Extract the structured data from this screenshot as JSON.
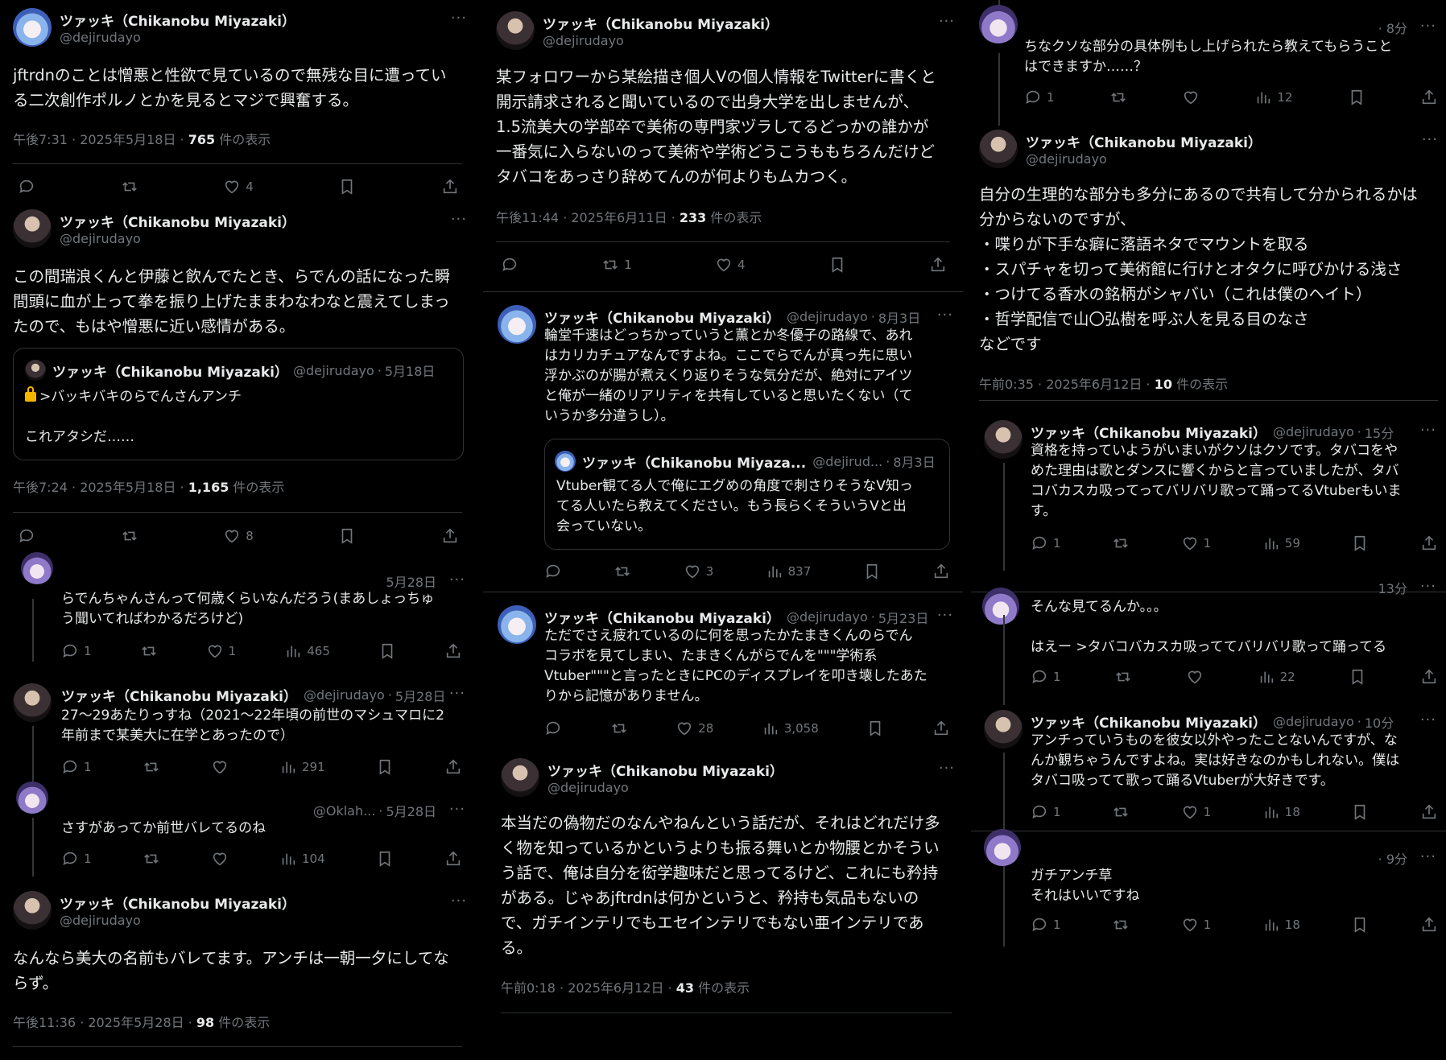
{
  "user": {
    "name": "ツァッキ（Chikanobu Miyazaki）",
    "handle": "@dejirudayo",
    "handle_short": "@dejirud...",
    "name_trunc": "ツァッキ（Chikanobu Miyaza..."
  },
  "other_user": {
    "handle": "@Oklah..."
  },
  "col1": {
    "t1": {
      "text": "jftrdnのことは憎悪と性欲で見ているので無残な目に遭ってい\nる二次創作ポルノとかを見るとマジで興奮する。",
      "meta": "午後7:31 · 2025年5月18日 · ",
      "views": "765",
      "views_suffix": " 件の表示",
      "likes": "4"
    },
    "t2": {
      "text": "この間瑞浪くんと伊藤と飲んでたとき、らでんの話になった瞬\n間頭に血が上って拳を振り上げたままわなわなと震えてしまっ\nたので、もはや憎悪に近い感情がある。",
      "quote_date": "5月18日",
      "quote_line1": ">バッキバキのらでんさんアンチ",
      "quote_line2": "これアタシだ……",
      "meta": "午後7:24 · 2025年5月18日 · ",
      "views": "1,165",
      "views_suffix": " 件の表示",
      "likes": "8"
    },
    "r1": {
      "date": "5月28日",
      "text": "らでんちゃんさんって何歳くらいなんだろう(まあしょっちゅ\nう聞いてればわかるだろけど)",
      "replies": "1",
      "likes": "1",
      "views": "465"
    },
    "r2": {
      "date": "5月28日",
      "text": "27〜29あたりっすね（2021〜22年頃の前世のマシュマロに2\n年前まで某美大に在学とあったので）",
      "replies": "1",
      "views": "291"
    },
    "r3": {
      "date": "5月28日",
      "text": "さすがあってか前世バレてるのね",
      "replies": "1",
      "views": "104"
    },
    "t3": {
      "text": "なんなら美大の名前もバレてます。アンチは一朝一夕にしてな\nらず。",
      "meta": "午後11:36 · 2025年5月28日 · ",
      "views": "98",
      "views_suffix": " 件の表示"
    }
  },
  "col2": {
    "t1": {
      "text": "某フォロワーから某絵描き個人Vの個人情報をTwitterに書くと\n開示請求されると聞いているので出身大学を出しませんが、\n1.5流美大の学部卒で美術の専門家ヅラしてるどっかの誰かが\n一番気に入らないのって美術や学術どうこうももちろんだけど\nタバコをあっさり辞めてんのが何よりもムカつく。",
      "meta": "午後11:44 · 2025年6月11日 · ",
      "views": "233",
      "views_suffix": " 件の表示",
      "retweets": "1",
      "likes": "4"
    },
    "r1": {
      "date": "8月3日",
      "text": "輪堂千速はどっちかっていうと薫とか冬優子の路線で、あれ\nはカリカチュアなんですよね。ここでらでんが真っ先に思い\n浮かぶのが腸が煮えくり返りそうな気分だが、絶対にアイツ\nと俺が一緒のリアリティを共有していると思いたくない（て\nいうか多分違うし）。",
      "quote_date": "8月3日",
      "quote_text": "Vtuber観てる人で俺にエグめの角度で刺さりそうなV知っ\nてる人いたら教えてください。もう長らくそういうVと出\n会っていない。",
      "likes": "3",
      "views": "837"
    },
    "r2": {
      "date": "5月23日",
      "text": "ただでさえ疲れているのに何を思ったかたまきくんのらでん\nコラボを見てしまい、たまきくんがらでんを\"\"\"学術系\nVtuber\"\"\"と言ったときにPCのディスプレイを叩き壊したあた\nりから記憶がありません。",
      "likes": "28",
      "views": "3,058"
    },
    "t2": {
      "text": "本当だの偽物だのなんやねんという話だが、それはどれだけ多\nく物を知っているかというよりも振る舞いとか物腰とかそうい\nう話で、俺は自分を衒学趣味だと思ってるけど、これにも矜持\nがある。じゃあjftrdnは何かというと、矜持も気品もないの\nで、ガチインテリでもエセインテリでもない亜インテリであ\nる。",
      "meta": "午前0:18 · 2025年6月12日 · ",
      "views": "43",
      "views_suffix": " 件の表示"
    }
  },
  "col3": {
    "r0": {
      "date": "8分",
      "text": "ちなクソな部分の具体例もし上げられたら教えてもらうこと\nはできますか……？",
      "replies": "1",
      "views": "12"
    },
    "t1": {
      "text": "自分の生理的な部分も多分にあるので共有して分かられるかは\n分からないのですが、\n・喋りが下手な癖に落語ネタでマウントを取る\n・スパチャを切って美術館に行けとオタクに呼びかける浅さ\n・つけてる香水の銘柄がシャバい（これは僕のヘイト）\n・哲学配信で山〇弘樹を呼ぶ人を見る目のなさ\nなどです",
      "meta": "午前0:35 · 2025年6月12日 · ",
      "views": "10",
      "views_suffix": " 件の表示"
    },
    "r1": {
      "date": "15分",
      "text": "資格を持っていようがいまいがクソはクソです。タバコをや\nめた理由は歌とダンスに響くからと言っていましたが、タバ\nコバカスカ吸ってってバリバリ歌って踊ってるVtuberもいま\nす。",
      "replies": "1",
      "likes": "1",
      "views": "59"
    },
    "r2": {
      "date": "13分",
      "text": "そんな見てるんか。。。\n\nはえー >タバコバカスカ吸っててバリバリ歌って踊ってる",
      "replies": "1",
      "views": "22"
    },
    "r3": {
      "date": "10分",
      "text": "アンチっていうものを彼女以外やったことないんですが、な\nんか観ちゃうんですよね。実は好きなのかもしれない。僕は\nタバコ吸ってて歌って踊るVtuberが大好きです。",
      "replies": "1",
      "likes": "1",
      "views": "18"
    },
    "r4": {
      "date": "9分",
      "text": "ガチアンチ草\nそれはいいですね",
      "replies": "1",
      "likes": "1",
      "views": "18"
    }
  },
  "icons": [
    "reply-icon",
    "retweet-icon",
    "like-icon",
    "views-icon",
    "bookmark-icon",
    "share-icon",
    "more-icon",
    "lock-icon"
  ]
}
